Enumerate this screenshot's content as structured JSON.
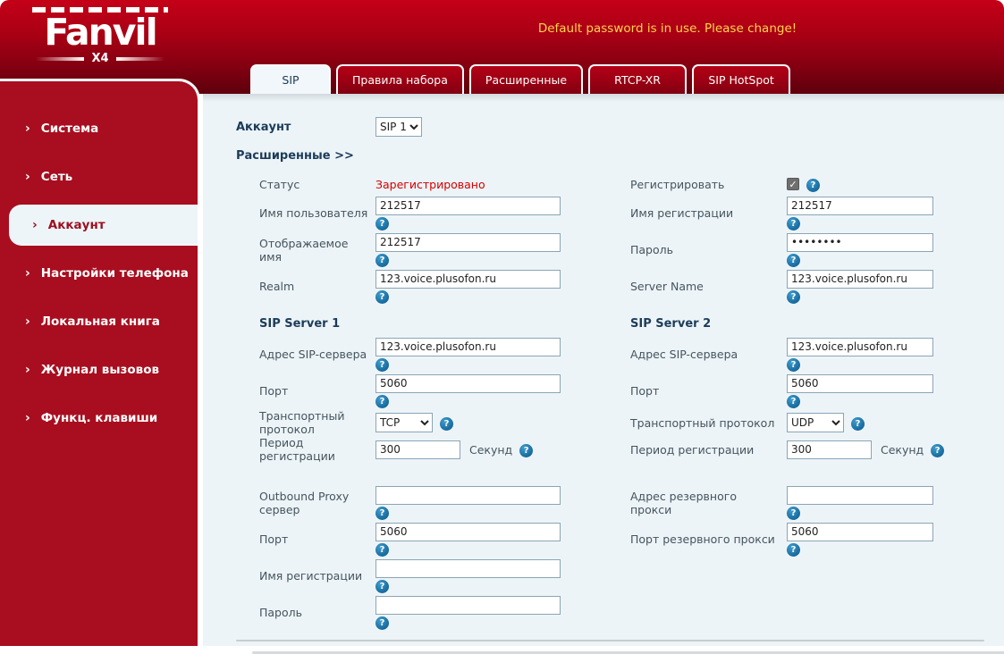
{
  "header": {
    "brand": "Fanvil",
    "model": "X4",
    "warning": "Default password is in use. Please change!"
  },
  "tabs": [
    {
      "label": "SIP",
      "active": true
    },
    {
      "label": "Правила набора",
      "active": false
    },
    {
      "label": "Расширенные",
      "active": false
    },
    {
      "label": "RTCP-XR",
      "active": false
    },
    {
      "label": "SIP HotSpot",
      "active": false
    }
  ],
  "sidebar": {
    "items": [
      {
        "label": "Система",
        "active": false
      },
      {
        "label": "Сеть",
        "active": false
      },
      {
        "label": "Аккаунт",
        "active": true
      },
      {
        "label": "Настройки телефона",
        "active": false
      },
      {
        "label": "Локальная книга",
        "active": false
      },
      {
        "label": "Журнал вызовов",
        "active": false
      },
      {
        "label": "Функц. клавиши",
        "active": false
      }
    ],
    "chevron": "›"
  },
  "account": {
    "label": "Аккаунт",
    "selected": "SIP 1",
    "advanced_label": "Расширенные >>"
  },
  "form": {
    "status": {
      "label": "Статус",
      "value": "Зарегистрировано"
    },
    "register": {
      "label": "Регистрировать",
      "checked": true
    },
    "username": {
      "label": "Имя пользователя",
      "value": "212517"
    },
    "reg_name": {
      "label": "Имя регистрации",
      "value": "212517"
    },
    "display_name": {
      "label": "Отображаемое имя",
      "value": "212517"
    },
    "password": {
      "label": "Пароль",
      "value": "••••••••"
    },
    "realm": {
      "label": "Realm",
      "value": "123.voice.plusofon.ru"
    },
    "server_name": {
      "label": "Server Name",
      "value": "123.voice.plusofon.ru"
    }
  },
  "sip_server_1": {
    "title": "SIP Server 1",
    "address": {
      "label": "Адрес SIP-сервера",
      "value": "123.voice.plusofon.ru"
    },
    "port": {
      "label": "Порт",
      "value": "5060"
    },
    "transport": {
      "label": "Транспортный протокол",
      "value": "TCP"
    },
    "reg_period": {
      "label": "Период регистрации",
      "value": "300",
      "unit": "Секунд"
    }
  },
  "sip_server_2": {
    "title": "SIP Server 2",
    "address": {
      "label": "Адрес SIP-сервера",
      "value": "123.voice.plusofon.ru"
    },
    "port": {
      "label": "Порт",
      "value": "5060"
    },
    "transport": {
      "label": "Транспортный протокол",
      "value": "UDP"
    },
    "reg_period": {
      "label": "Период регистрации",
      "value": "300",
      "unit": "Секунд"
    }
  },
  "proxy": {
    "outbound": {
      "label": "Outbound Proxy сервер",
      "value": ""
    },
    "backup_address": {
      "label": "Адрес резервного прокси",
      "value": ""
    },
    "port": {
      "label": "Порт",
      "value": "5060"
    },
    "backup_port": {
      "label": "Порт резервного прокси",
      "value": "5060"
    },
    "auth_name": {
      "label": "Имя регистрации",
      "value": ""
    },
    "auth_password": {
      "label": "Пароль",
      "value": ""
    }
  },
  "colors": {
    "header_red": "#a80e1f",
    "warning_yellow": "#ffd34d",
    "status_red": "#d40000",
    "accent_blue": "#176a9e",
    "content_bg": "#edf4f8"
  }
}
